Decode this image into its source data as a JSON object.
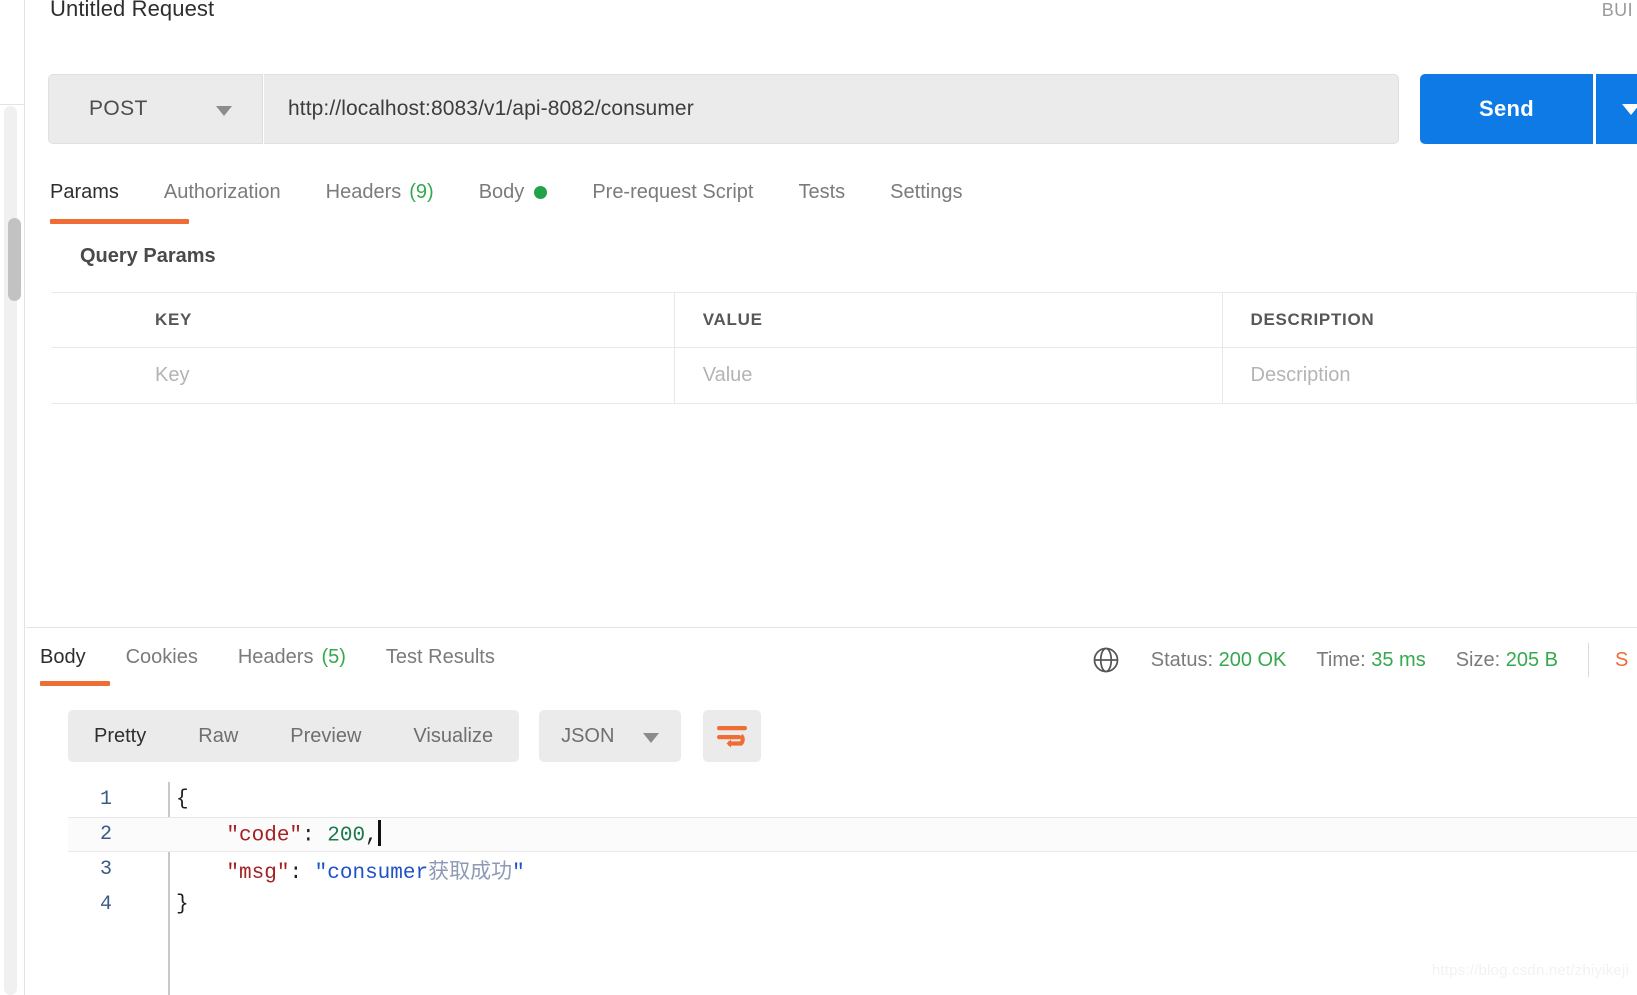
{
  "header": {
    "request_title": "Untitled Request",
    "build_label": "BUI"
  },
  "url_bar": {
    "method": "POST",
    "method_caret_icon": "chevron-down-icon",
    "url": "http://localhost:8083/v1/api-8082/consumer",
    "send_label": "Send",
    "send_caret_icon": "chevron-down-icon"
  },
  "request_tabs": [
    {
      "label": "Params",
      "active": true,
      "count": "",
      "dot": false
    },
    {
      "label": "Authorization",
      "active": false,
      "count": "",
      "dot": false
    },
    {
      "label": "Headers",
      "active": false,
      "count": "(9)",
      "dot": false
    },
    {
      "label": "Body",
      "active": false,
      "count": "",
      "dot": true
    },
    {
      "label": "Pre-request Script",
      "active": false,
      "count": "",
      "dot": false
    },
    {
      "label": "Tests",
      "active": false,
      "count": "",
      "dot": false
    },
    {
      "label": "Settings",
      "active": false,
      "count": "",
      "dot": false
    }
  ],
  "query_params": {
    "section_title": "Query Params",
    "columns": [
      "KEY",
      "VALUE",
      "DESCRIPTION"
    ],
    "rows": [
      {
        "key": "Key",
        "value": "Value",
        "description": "Description"
      }
    ]
  },
  "response_tabs": [
    {
      "label": "Body",
      "active": true,
      "count": ""
    },
    {
      "label": "Cookies",
      "active": false,
      "count": ""
    },
    {
      "label": "Headers",
      "active": false,
      "count": "(5)"
    },
    {
      "label": "Test Results",
      "active": false,
      "count": ""
    }
  ],
  "response_status": {
    "globe_icon": "globe-icon",
    "status_label": "Status:",
    "status_value": "200 OK",
    "time_label": "Time:",
    "time_value": "35 ms",
    "size_label": "Size:",
    "size_value": "205 B",
    "save_response_label": "S"
  },
  "response_toolbar": {
    "views": [
      "Pretty",
      "Raw",
      "Preview",
      "Visualize"
    ],
    "active_view": "Pretty",
    "format": "JSON",
    "format_caret_icon": "chevron-down-icon",
    "wrap_icon": "wrap-text-icon"
  },
  "response_body": {
    "language": "json",
    "lines": [
      {
        "number": "1",
        "highlight": false,
        "tokens": [
          {
            "t": "{",
            "c": "brace"
          }
        ]
      },
      {
        "number": "2",
        "highlight": true,
        "tokens": [
          {
            "t": "    ",
            "c": "punc"
          },
          {
            "t": "\"code\"",
            "c": "key"
          },
          {
            "t": ": ",
            "c": "punc"
          },
          {
            "t": "200",
            "c": "num"
          },
          {
            "t": ",",
            "c": "punc"
          },
          {
            "t": "|CURSOR|",
            "c": "cursor"
          }
        ]
      },
      {
        "number": "3",
        "highlight": false,
        "tokens": [
          {
            "t": "    ",
            "c": "punc"
          },
          {
            "t": "\"msg\"",
            "c": "key"
          },
          {
            "t": ": ",
            "c": "punc"
          },
          {
            "t": "\"consumer",
            "c": "str"
          },
          {
            "t": "获取成功",
            "c": "cn"
          },
          {
            "t": "\"",
            "c": "str"
          }
        ]
      },
      {
        "number": "4",
        "highlight": false,
        "tokens": [
          {
            "t": "}",
            "c": "brace"
          }
        ]
      }
    ],
    "raw_text": "{\n    \"code\": 200,\n    \"msg\": \"consumer获取成功\"\n}"
  },
  "watermark": "https://blog.csdn.net/zhiyikeji",
  "colors": {
    "accent_orange": "#ef6c35",
    "send_blue": "#0d7ae5",
    "success_green": "#35a94e",
    "field_gray": "#ebebeb",
    "border_gray": "#e8e8e8",
    "json_key_red": "#a52121",
    "json_number_green": "#1a7a4c",
    "json_string_blue": "#1f52c4"
  }
}
